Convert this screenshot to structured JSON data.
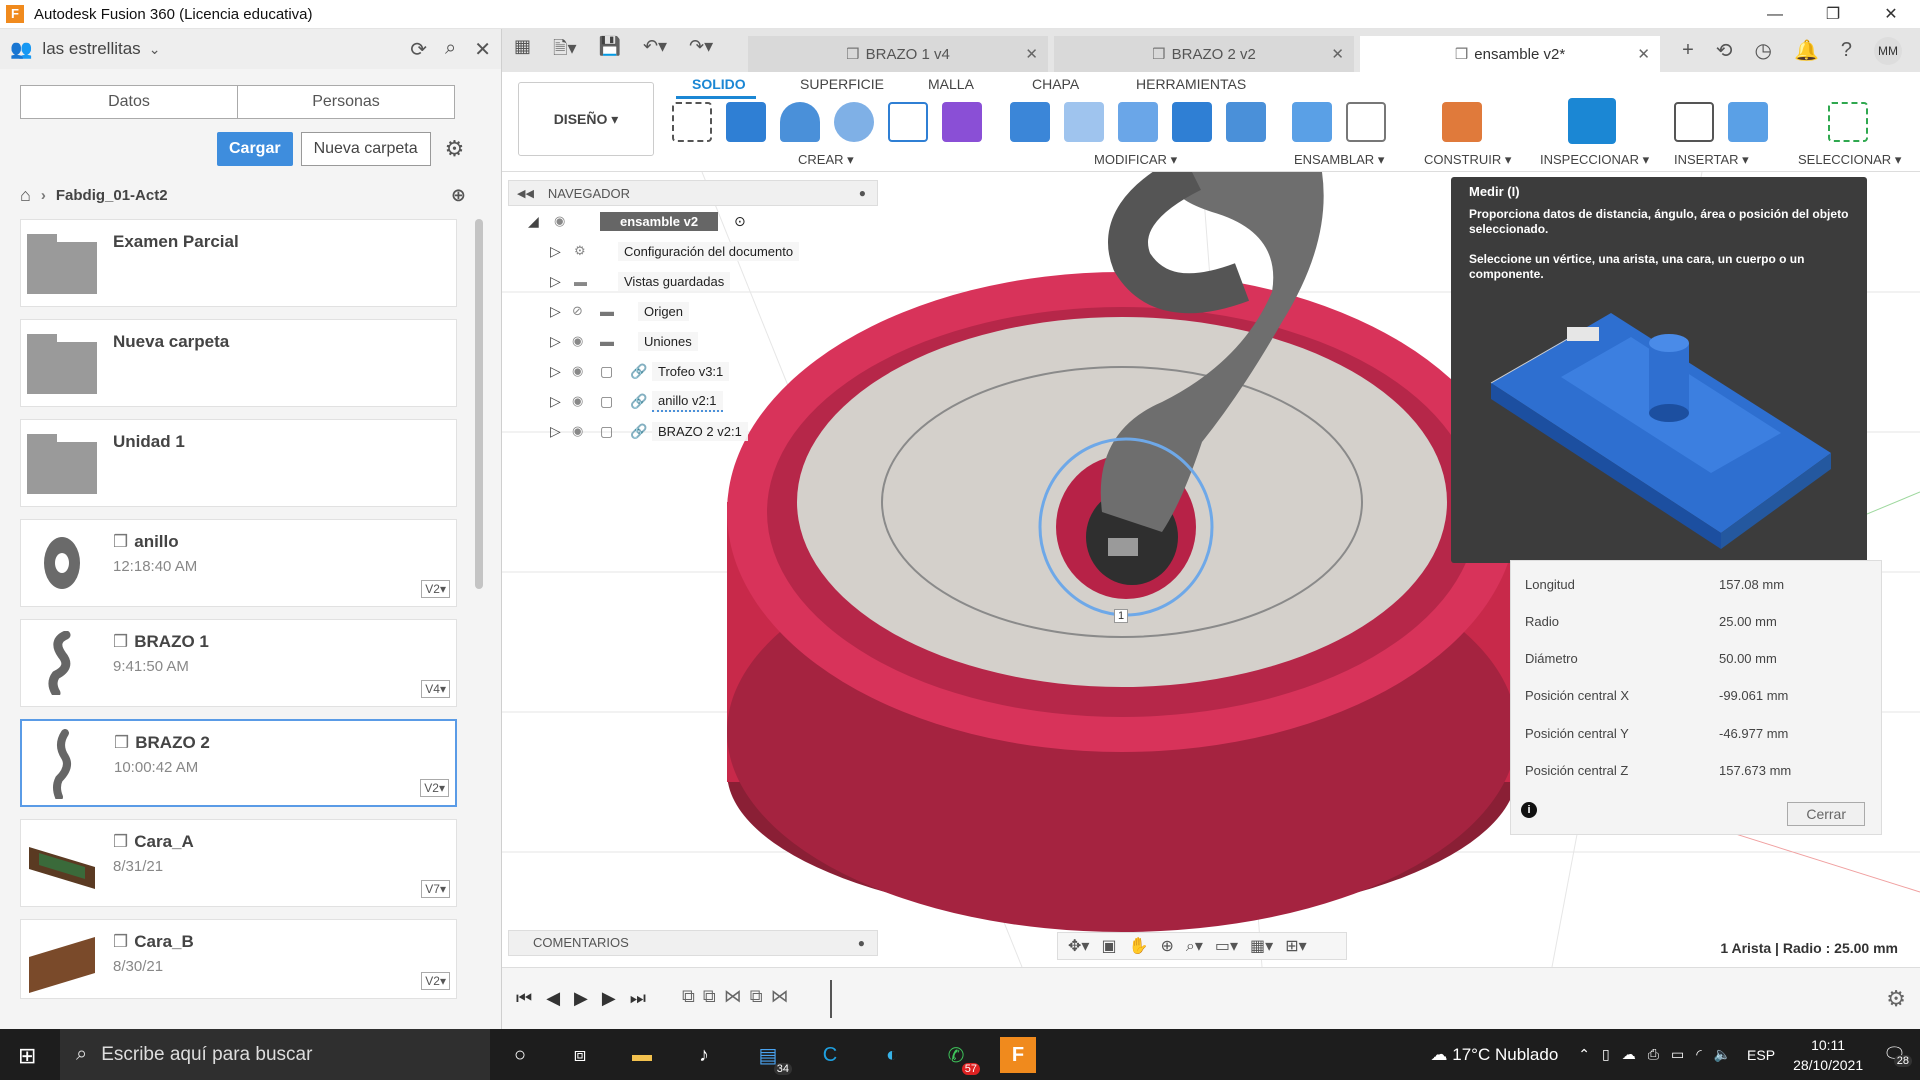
{
  "window": {
    "title": "Autodesk Fusion 360 (Licencia educativa)",
    "app_icon": "F"
  },
  "datapanel": {
    "team": "las estrellitas",
    "tabs": [
      "Datos",
      "Personas"
    ],
    "upload_label": "Cargar",
    "new_folder_label": "Nueva carpeta",
    "breadcrumb": "Fabdig_01-Act2",
    "items": [
      {
        "name": "Examen Parcial",
        "type": "folder"
      },
      {
        "name": "Nueva carpeta",
        "type": "folder"
      },
      {
        "name": "Unidad 1",
        "type": "folder"
      },
      {
        "name": "anillo",
        "time": "12:18:40 AM",
        "version": "V2"
      },
      {
        "name": "BRAZO 1",
        "time": "9:41:50 AM",
        "version": "V4"
      },
      {
        "name": "BRAZO 2",
        "time": "10:00:42 AM",
        "version": "V2"
      },
      {
        "name": "Cara_A",
        "time": "8/31/21",
        "version": "V7"
      },
      {
        "name": "Cara_B",
        "time": "8/30/21",
        "version": "V2"
      }
    ]
  },
  "tabs": [
    {
      "label": "BRAZO 1 v4"
    },
    {
      "label": "BRAZO 2 v2"
    },
    {
      "label": "ensamble v2*"
    }
  ],
  "user_initials": "MM",
  "ribbon": {
    "workspace": "DISEÑO",
    "tabs": [
      "SOLIDO",
      "SUPERFICIE",
      "MALLA",
      "CHAPA",
      "HERRAMIENTAS"
    ],
    "groups": [
      "CREAR",
      "MODIFICAR",
      "ENSAMBLAR",
      "CONSTRUIR",
      "INSPECCIONAR",
      "INSERTAR",
      "SELECCIONAR"
    ]
  },
  "navigator": {
    "title": "NAVEGADOR",
    "root": "ensamble v2",
    "items": [
      "Configuración del documento",
      "Vistas guardadas",
      "Origen",
      "Uniones",
      "Trofeo v3:1",
      "anillo v2:1",
      "BRAZO 2 v2:1"
    ]
  },
  "tooltip": {
    "title": "Medir (I)",
    "desc1": "Proporciona datos de distancia, ángulo, área o posición del objeto seleccionado.",
    "desc2": "Seleccione un vértice, una arista, una cara, un cuerpo o un componente."
  },
  "measure": {
    "rows": [
      {
        "label": "Longitud",
        "value": "157.08 mm"
      },
      {
        "label": "Radio",
        "value": "25.00 mm"
      },
      {
        "label": "Diámetro",
        "value": "50.00 mm"
      },
      {
        "label": "Posición central X",
        "value": "-99.061 mm"
      },
      {
        "label": "Posición central Y",
        "value": "-46.977 mm"
      },
      {
        "label": "Posición central Z",
        "value": "157.673 mm"
      }
    ],
    "close_label": "Cerrar"
  },
  "viewport": {
    "point_label": "1"
  },
  "comments_label": "COMENTARIOS",
  "status_text": "1 Arista | Radio : 25.00 mm",
  "taskbar": {
    "search_placeholder": "Escribe aquí para buscar",
    "badge_store": "34",
    "badge_whatsapp": "57",
    "weather": "17°C  Nublado",
    "lang": "ESP",
    "time": "10:11",
    "date": "28/10/2021",
    "notifications": "28"
  },
  "colors": {
    "accent": "#1b87d4",
    "upload_button": "#3e8ddd",
    "model_red": "#c8294a"
  }
}
